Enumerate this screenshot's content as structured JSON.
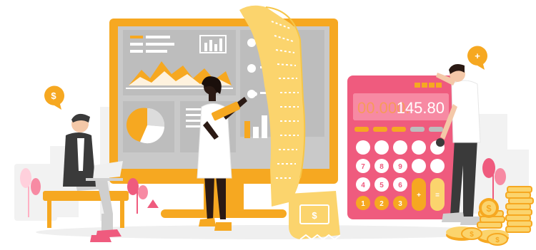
{
  "calculator": {
    "display_dim": "00.000.",
    "display_value": "145.80",
    "keys": [
      "7",
      "8",
      "9",
      "4",
      "5",
      "6",
      "1",
      "2",
      "3",
      "+",
      "="
    ]
  },
  "badges": {
    "left_symbol": "$",
    "right_symbol": "+"
  },
  "receipt": {
    "symbol": "$"
  },
  "coins": {
    "symbol": "$"
  },
  "colors": {
    "accent": "#f6a821",
    "calculator": "#ef5b7e",
    "monitor_screen": "#c9c9c9",
    "dark": "#3a3a3a",
    "skin": "#2b1a14"
  },
  "icons": [
    "dollar-badge-icon",
    "plus-badge-icon",
    "receipt-dollar-icon",
    "coin-dollar-icon"
  ]
}
